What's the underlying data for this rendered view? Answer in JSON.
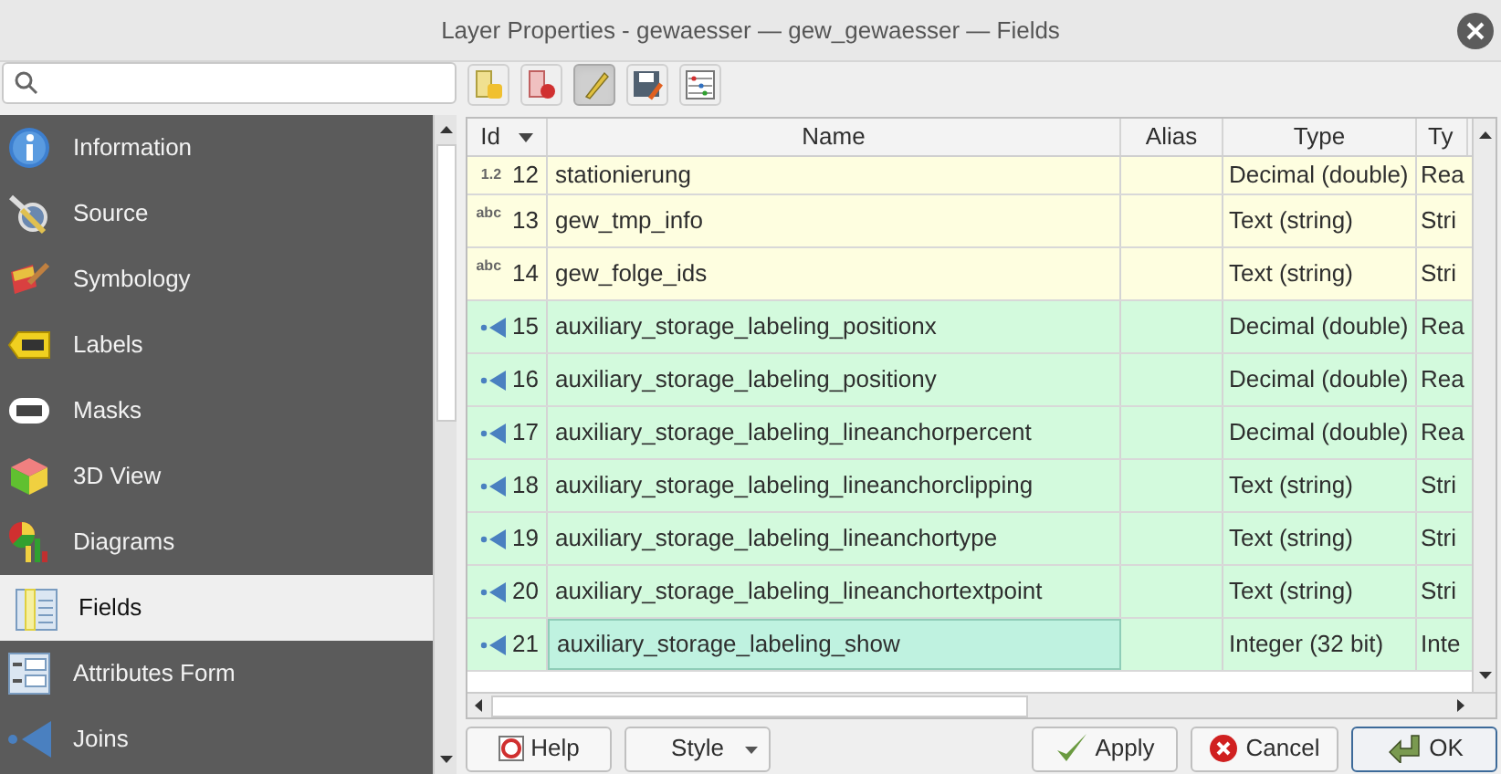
{
  "window": {
    "title": "Layer Properties - gewaesser — gew_gewaesser — Fields"
  },
  "sidebar": {
    "items": [
      {
        "label": "Information",
        "selected": false
      },
      {
        "label": "Source",
        "selected": false
      },
      {
        "label": "Symbology",
        "selected": false
      },
      {
        "label": "Labels",
        "selected": false
      },
      {
        "label": "Masks",
        "selected": false
      },
      {
        "label": "3D View",
        "selected": false
      },
      {
        "label": "Diagrams",
        "selected": false
      },
      {
        "label": "Fields",
        "selected": true
      },
      {
        "label": "Attributes Form",
        "selected": false
      },
      {
        "label": "Joins",
        "selected": false
      }
    ]
  },
  "toolbar": {
    "buttons": [
      {
        "kind": "new-field",
        "pressed": false
      },
      {
        "kind": "delete-field",
        "pressed": false
      },
      {
        "kind": "edit",
        "pressed": true
      },
      {
        "kind": "save",
        "pressed": false
      },
      {
        "kind": "calculator",
        "pressed": false
      }
    ]
  },
  "table": {
    "columns": [
      "Id",
      "Name",
      "Alias",
      "Type",
      "Ty"
    ],
    "rows": [
      {
        "kind": "decimal",
        "type_label": "1.2",
        "id": "12",
        "name": "stationierung",
        "alias": "",
        "type": "Decimal (double)",
        "column_5": "Rea",
        "selected": false
      },
      {
        "kind": "text",
        "type_label": "abc",
        "id": "13",
        "name": "gew_tmp_info",
        "alias": "",
        "type": "Text (string)",
        "column_5": "Stri",
        "selected": false
      },
      {
        "kind": "text",
        "type_label": "abc",
        "id": "14",
        "name": "gew_folge_ids",
        "alias": "",
        "type": "Text (string)",
        "column_5": "Stri",
        "selected": false
      },
      {
        "kind": "join",
        "id": "15",
        "name": "auxiliary_storage_labeling_positionx",
        "type": "Decimal (double)",
        "column_5": "Rea",
        "selected": false
      },
      {
        "kind": "join",
        "id": "16",
        "name": "auxiliary_storage_labeling_positiony",
        "type": "Decimal (double)",
        "column_5": "Rea",
        "selected": false
      },
      {
        "kind": "join",
        "id": "17",
        "name": "auxiliary_storage_labeling_lineanchorpercent",
        "type": "Decimal (double)",
        "column_5": "Rea",
        "selected": false
      },
      {
        "kind": "join",
        "id": "18",
        "name": "auxiliary_storage_labeling_lineanchorclipping",
        "type": "Text (string)",
        "column_5": "Stri",
        "selected": false
      },
      {
        "kind": "join",
        "id": "19",
        "name": "auxiliary_storage_labeling_lineanchortype",
        "type": "Text (string)",
        "column_5": "Stri",
        "selected": false
      },
      {
        "kind": "join",
        "id": "20",
        "name": "auxiliary_storage_labeling_lineanchortextpoint",
        "type": "Text (string)",
        "column_5": "Stri",
        "selected": false
      },
      {
        "kind": "join",
        "id": "21",
        "name": "auxiliary_storage_labeling_show",
        "type": "Integer (32 bit)",
        "column_5": "Inte",
        "selected": true
      }
    ]
  },
  "buttons": [
    {
      "kind": "help",
      "label": "Help"
    },
    {
      "kind": "style",
      "label": "Style"
    },
    {
      "kind": "apply",
      "label": "Apply"
    },
    {
      "kind": "cancel",
      "label": "Cancel"
    },
    {
      "kind": "ok",
      "label": "OK"
    }
  ]
}
